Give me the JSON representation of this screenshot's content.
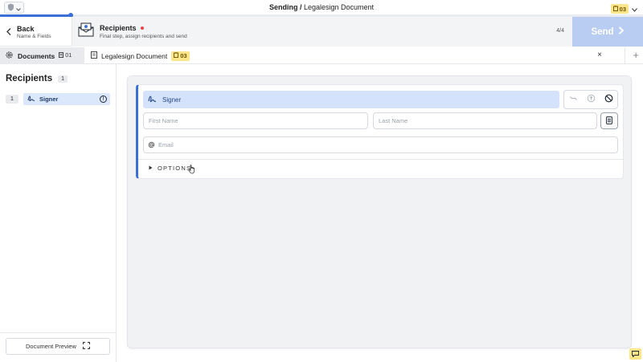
{
  "topbar": {
    "title_prefix": "Sending /",
    "title_doc": "Legalesign Document",
    "badge_count": "03"
  },
  "progress": {
    "fraction": 0.11
  },
  "header": {
    "back_label": "Back",
    "back_sub": "Name & Fields",
    "step_title": "Recipients",
    "step_sub": "Final step, assign recipients and send",
    "step_count": "4/4",
    "send_label": "Send"
  },
  "tabs": {
    "documents_label": "Documents",
    "documents_count": "01",
    "doc_name": "Legalesign Document",
    "doc_badge": "03",
    "close": "×",
    "add": "+"
  },
  "sidebar": {
    "title": "Recipients",
    "count": "1",
    "items": [
      {
        "number": "1",
        "role": "Signer"
      }
    ],
    "preview_label": "Document Preview"
  },
  "recipient": {
    "role": "Signer",
    "first_name_placeholder": "First Name",
    "last_name_placeholder": "Last Name",
    "email_placeholder": "Email",
    "options_label": "OPTIONS"
  },
  "colors": {
    "accent": "#3b6fd8",
    "send_disabled": "#b8cdf1",
    "role_pill": "#d4e2fb",
    "badge_yellow": "#fde68a",
    "status_red": "#ef4444"
  },
  "icons": [
    "shield-icon",
    "chevron-down-icon",
    "clipboard-icon",
    "chevron-left-icon",
    "envelope-icon",
    "chevron-right-icon",
    "gear-icon",
    "document-icon",
    "signature-icon",
    "info-icon",
    "expand-icon",
    "link-icon",
    "upload-icon",
    "block-icon",
    "contact-card-icon",
    "at-icon",
    "triangle-right-icon",
    "hand-cursor-icon",
    "chat-icon"
  ]
}
